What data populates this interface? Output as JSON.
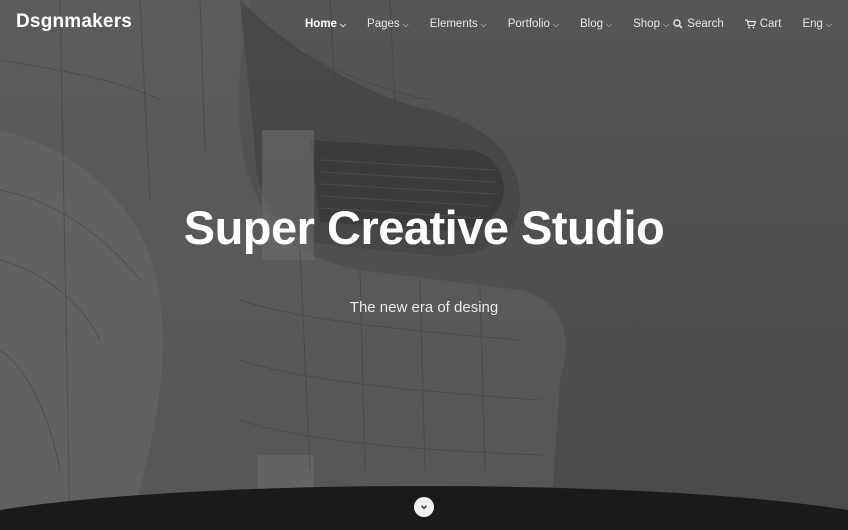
{
  "brand": {
    "logo": "Dsgnmakers"
  },
  "nav": {
    "items": [
      {
        "label": "Home",
        "active": true
      },
      {
        "label": "Pages",
        "active": false
      },
      {
        "label": "Elements",
        "active": false
      },
      {
        "label": "Portfolio",
        "active": false
      },
      {
        "label": "Blog",
        "active": false
      },
      {
        "label": "Shop",
        "active": false
      }
    ]
  },
  "tools": {
    "search_label": "Search",
    "cart_label": "Cart",
    "language_label": "Eng"
  },
  "hero": {
    "title": "Super Creative Studio",
    "subtitle": "The new era of desing"
  },
  "icons": {
    "search": "search-icon",
    "cart": "cart-icon",
    "scroll": "chevron-down-icon"
  },
  "colors": {
    "overlay": "#555555",
    "text": "#ffffff",
    "bottom": "#1a1a1a"
  }
}
